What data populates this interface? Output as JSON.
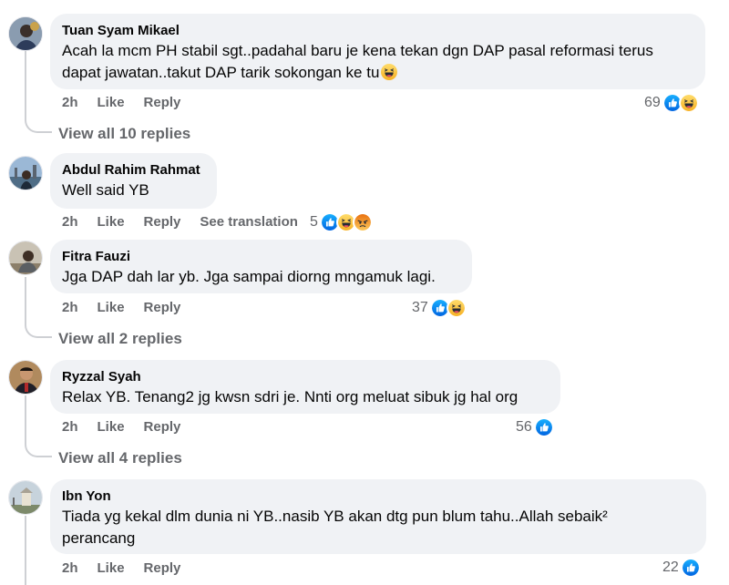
{
  "comments": [
    {
      "author": "Tuan Syam Mikael",
      "text": "Acah la mcm PH stabil sgt..padahal baru je kena tekan dgn DAP pasal reformasi terus dapat jawatan..takut DAP tarik sokongan ke tu",
      "time": "2h",
      "like_label": "Like",
      "reply_label": "Reply",
      "reaction_count": "69",
      "reactions": [
        "like-icon",
        "haha-icon"
      ],
      "view_replies": "View all 10 replies"
    },
    {
      "author": "Abdul Rahim Rahmat",
      "text": "Well said YB",
      "time": "2h",
      "like_label": "Like",
      "reply_label": "Reply",
      "see_translation": "See translation",
      "reaction_count": "5",
      "reactions": [
        "like-icon",
        "haha-icon",
        "angry-icon"
      ]
    },
    {
      "author": "Fitra Fauzi",
      "text": "Jga DAP dah lar yb. Jga sampai diorng mngamuk lagi.",
      "time": "2h",
      "like_label": "Like",
      "reply_label": "Reply",
      "reaction_count": "37",
      "reactions": [
        "like-icon",
        "haha-icon"
      ],
      "view_replies": "View all 2 replies"
    },
    {
      "author": "Ryzzal Syah",
      "text": "Relax YB. Tenang2 jg kwsn sdri je. Nnti org meluat sibuk jg hal org",
      "time": "2h",
      "like_label": "Like",
      "reply_label": "Reply",
      "reaction_count": "56",
      "reactions": [
        "like-icon"
      ],
      "view_replies": "View all 4 replies"
    },
    {
      "author": "Ibn Yon",
      "text_line1": "Tiada yg kekal dlm dunia ni YB..nasib YB akan dtg pun blum tahu..Allah sebaik²",
      "text_line2": "perancang",
      "time": "2h",
      "like_label": "Like",
      "reply_label": "Reply",
      "reaction_count": "22",
      "reactions": [
        "like-icon"
      ]
    }
  ],
  "colors": {
    "bubble_bg": "#f0f2f5",
    "secondary_text": "#65676b",
    "like_blue": "#1877f2",
    "haha_yellow": "#f7b928",
    "angry_orange": "#e9710f"
  }
}
